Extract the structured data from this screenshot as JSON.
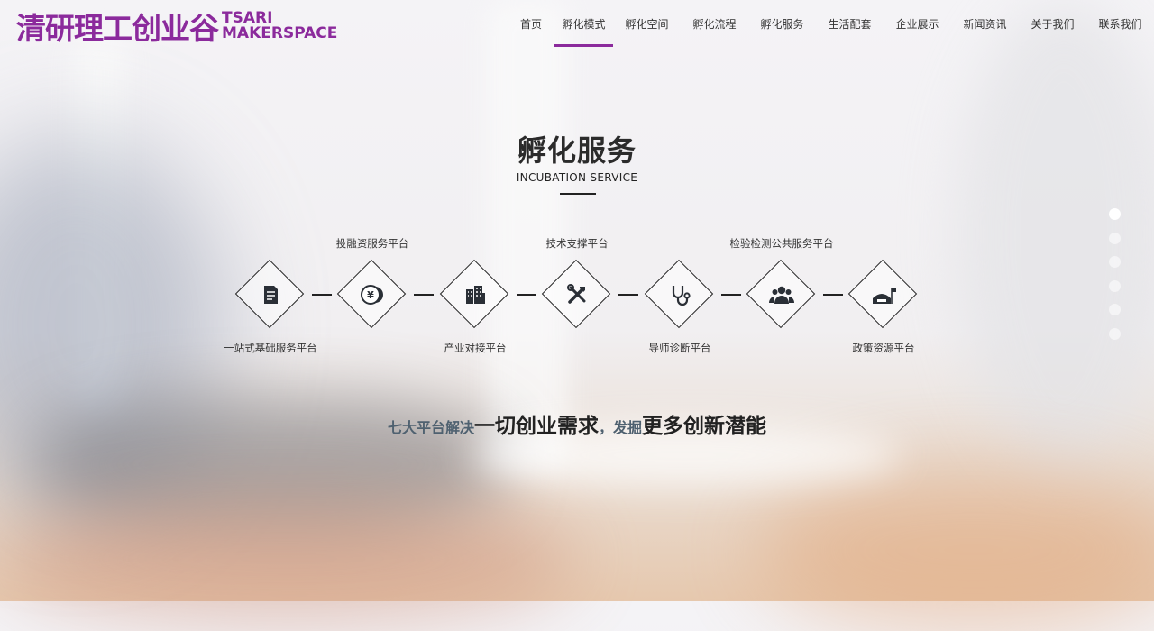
{
  "logo": {
    "cn": "清研理工创业谷",
    "en_line1": "TSARI",
    "en_line2": "MAKERSPACE",
    "mark": "®"
  },
  "nav": {
    "items": [
      {
        "label": "首页"
      },
      {
        "label": "孵化模式",
        "active": true
      },
      {
        "label": "孵化空间"
      },
      {
        "label": "孵化流程"
      },
      {
        "label": "孵化服务"
      },
      {
        "label": "生活配套"
      },
      {
        "label": "企业展示"
      },
      {
        "label": "新闻资讯"
      },
      {
        "label": "关于我们"
      },
      {
        "label": "联系我们"
      }
    ],
    "active_color": "#8b2a9c"
  },
  "section": {
    "title": "孵化服务",
    "subtitle": "INCUBATION SERVICE"
  },
  "services": [
    {
      "label": "一站式基础服务平台",
      "position": "bottom",
      "icon": "document-icon"
    },
    {
      "label": "投融资服务平台",
      "position": "top",
      "icon": "coins-icon"
    },
    {
      "label": "产业对接平台",
      "position": "bottom",
      "icon": "buildings-icon"
    },
    {
      "label": "技术支撑平台",
      "position": "top",
      "icon": "tools-icon"
    },
    {
      "label": "导师诊断平台",
      "position": "bottom",
      "icon": "stethoscope-icon"
    },
    {
      "label": "检验检测公共服务平台",
      "position": "top",
      "icon": "group-icon"
    },
    {
      "label": "政策资源平台",
      "position": "bottom",
      "icon": "flag-building-icon"
    }
  ],
  "slogan": {
    "part1": "七大平台解决",
    "part2": "一切创业需求",
    "part3": "，发掘",
    "part4": "更多创新潜能"
  },
  "pager": {
    "count": 6,
    "active": 1
  }
}
